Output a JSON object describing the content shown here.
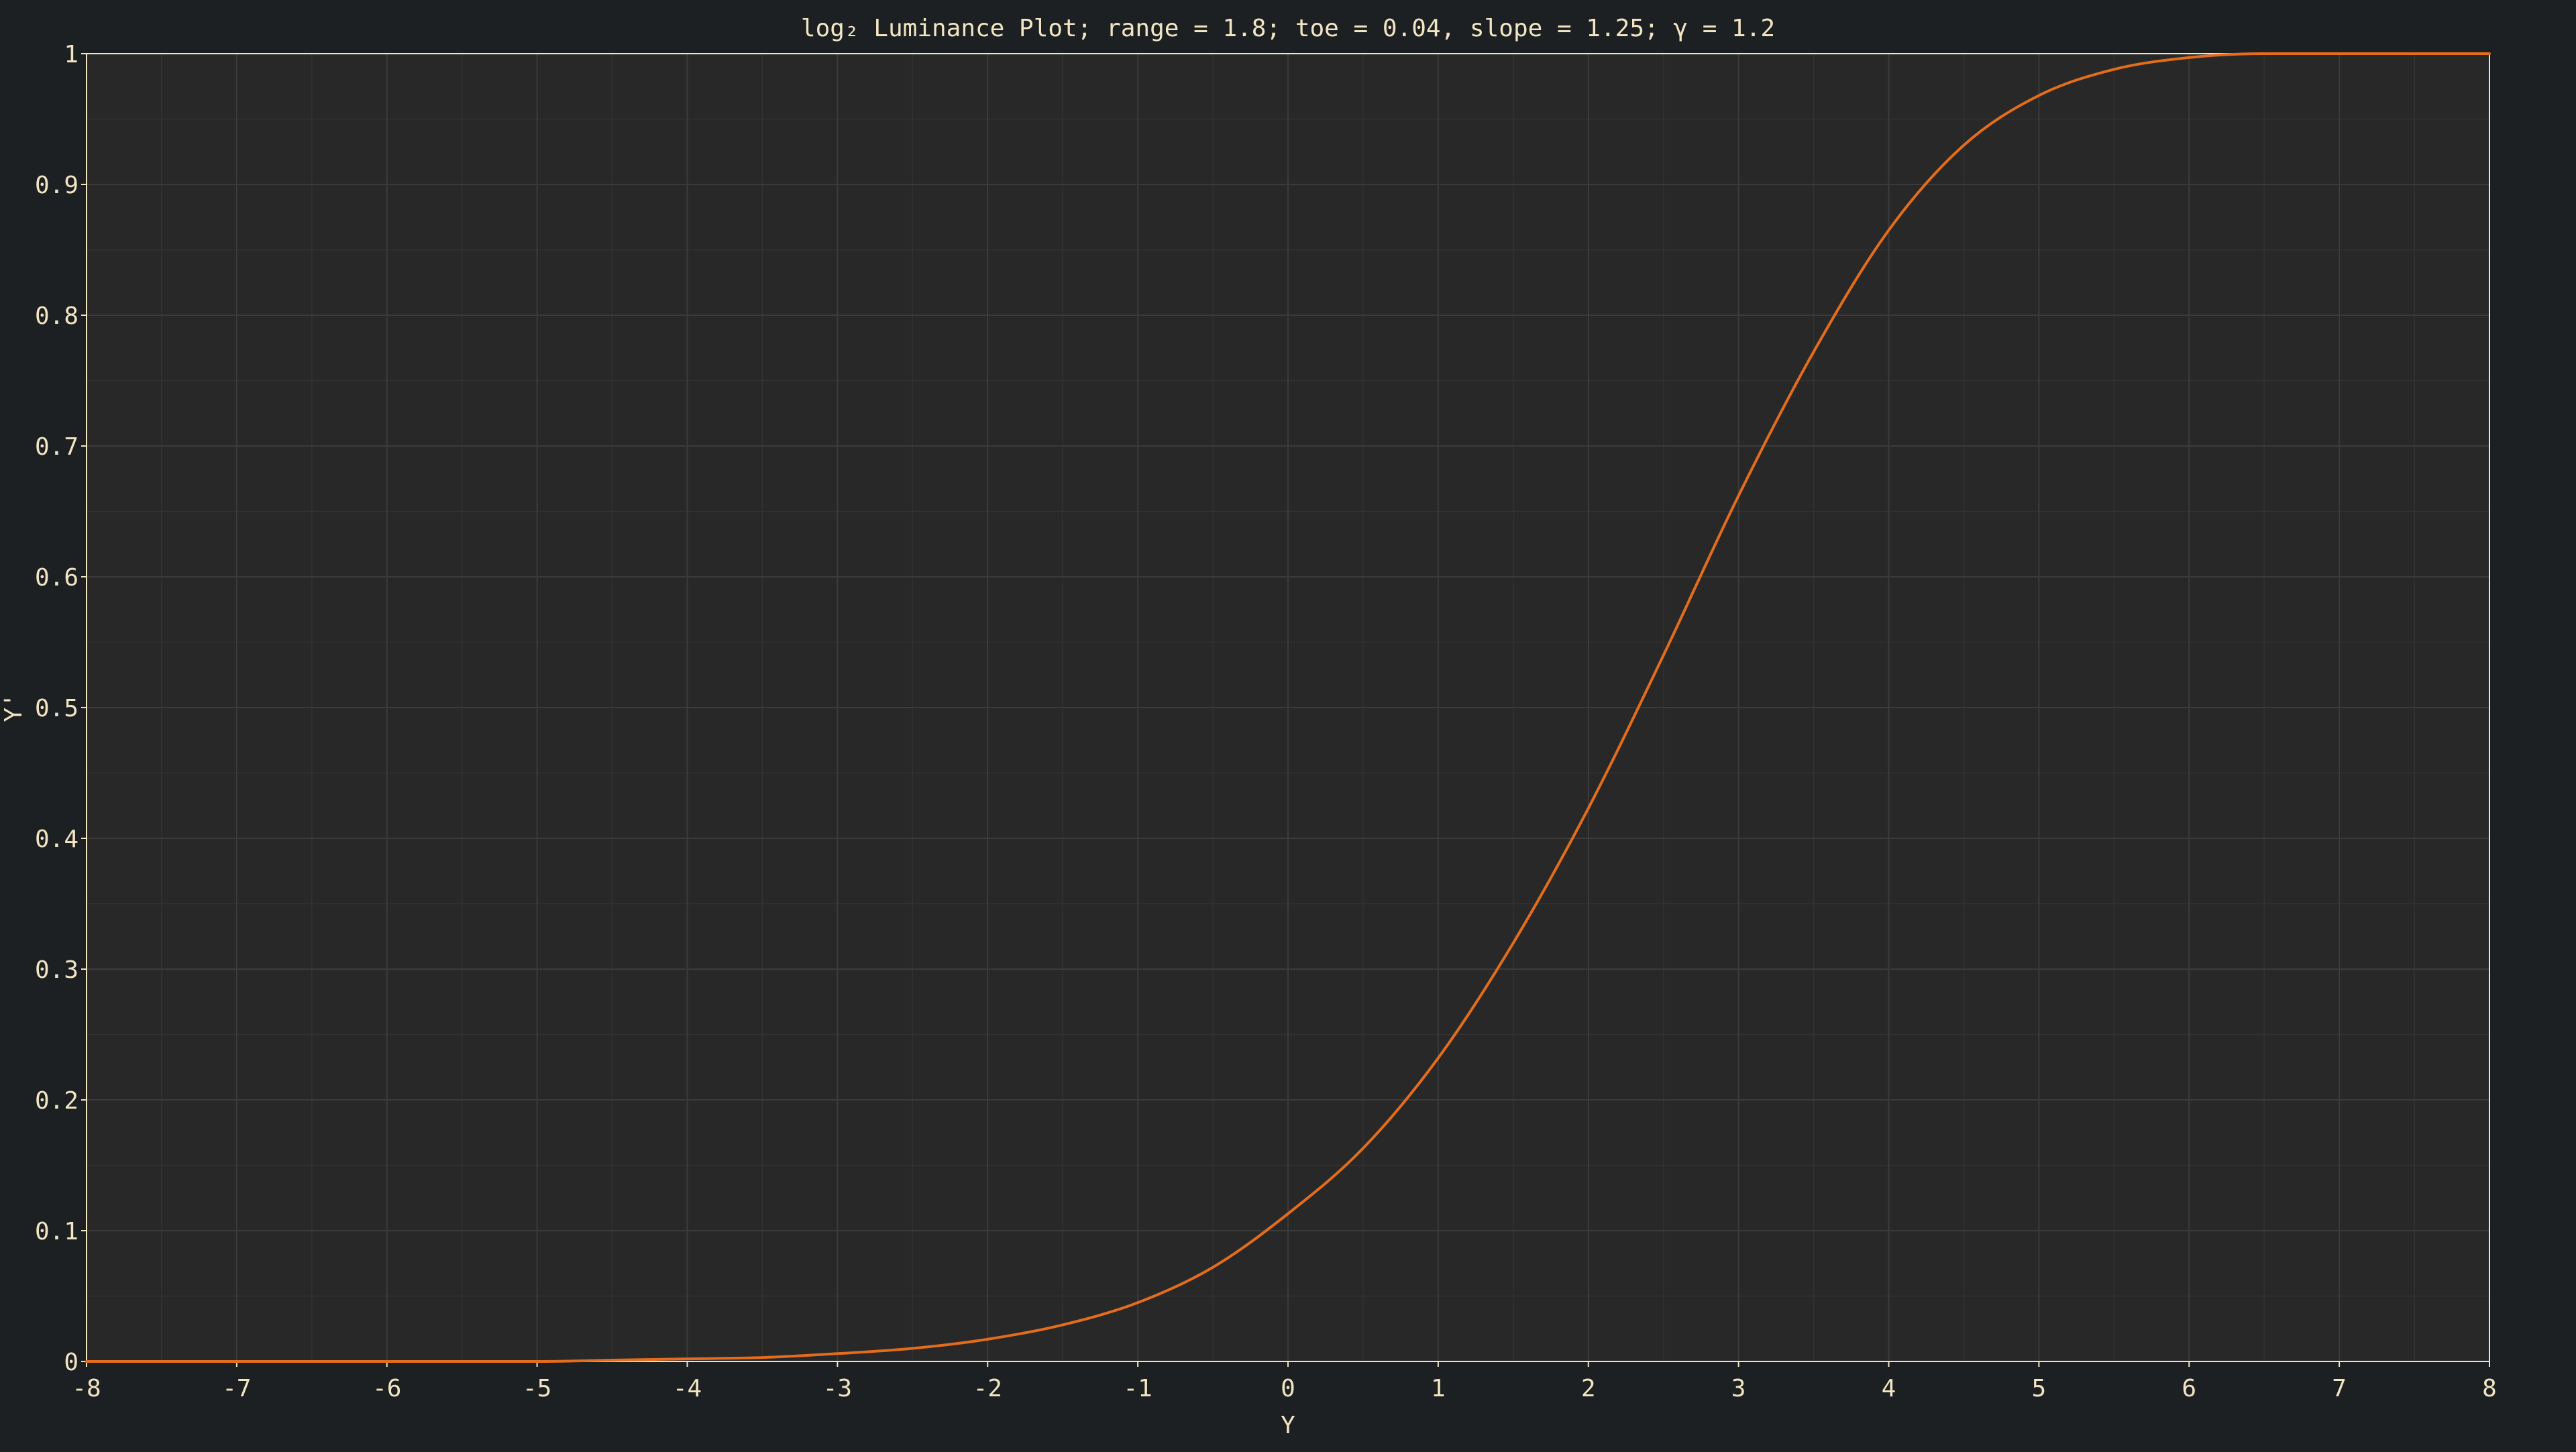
{
  "chart_data": {
    "type": "line",
    "title": "log₂ Luminance Plot; range = 1.8; toe = 0.04, slope = 1.25; γ = 1.2",
    "xlabel": "Y",
    "ylabel": "Y'",
    "xlim": [
      -8,
      8
    ],
    "ylim": [
      0,
      1
    ],
    "x_ticks": [
      "-8",
      "-7",
      "-6",
      "-5",
      "-4",
      "-3",
      "-2",
      "-1",
      "0",
      "1",
      "2",
      "3",
      "4",
      "5",
      "6",
      "7",
      "8"
    ],
    "y_ticks": [
      "0",
      "0.1",
      "0.2",
      "0.3",
      "0.4",
      "0.5",
      "0.6",
      "0.7",
      "0.8",
      "0.9",
      "1"
    ],
    "grid": true,
    "series": [
      {
        "color": "#e36d1c",
        "x": [
          -8,
          -7,
          -6,
          -5,
          -4.5,
          -4,
          -3.5,
          -3,
          -2.5,
          -2,
          -1.5,
          -1,
          -0.5,
          0,
          0.5,
          1,
          1.5,
          2,
          2.5,
          3,
          3.5,
          4,
          4.5,
          5,
          5.5,
          6,
          6.5,
          7,
          8
        ],
        "y": [
          0,
          0,
          0,
          0,
          0.001,
          0.002,
          0.003,
          0.006,
          0.01,
          0.017,
          0.028,
          0.045,
          0.072,
          0.113,
          0.163,
          0.232,
          0.32,
          0.423,
          0.54,
          0.662,
          0.772,
          0.865,
          0.93,
          0.968,
          0.988,
          0.997,
          1,
          1,
          1
        ]
      }
    ],
    "colors": {
      "background": "#1d2022",
      "plot_background": "#282828",
      "grid": "#3b3b3b",
      "frame": "#f2e5c4",
      "text": "#f2e5c4",
      "curve": "#e36d1c"
    }
  }
}
